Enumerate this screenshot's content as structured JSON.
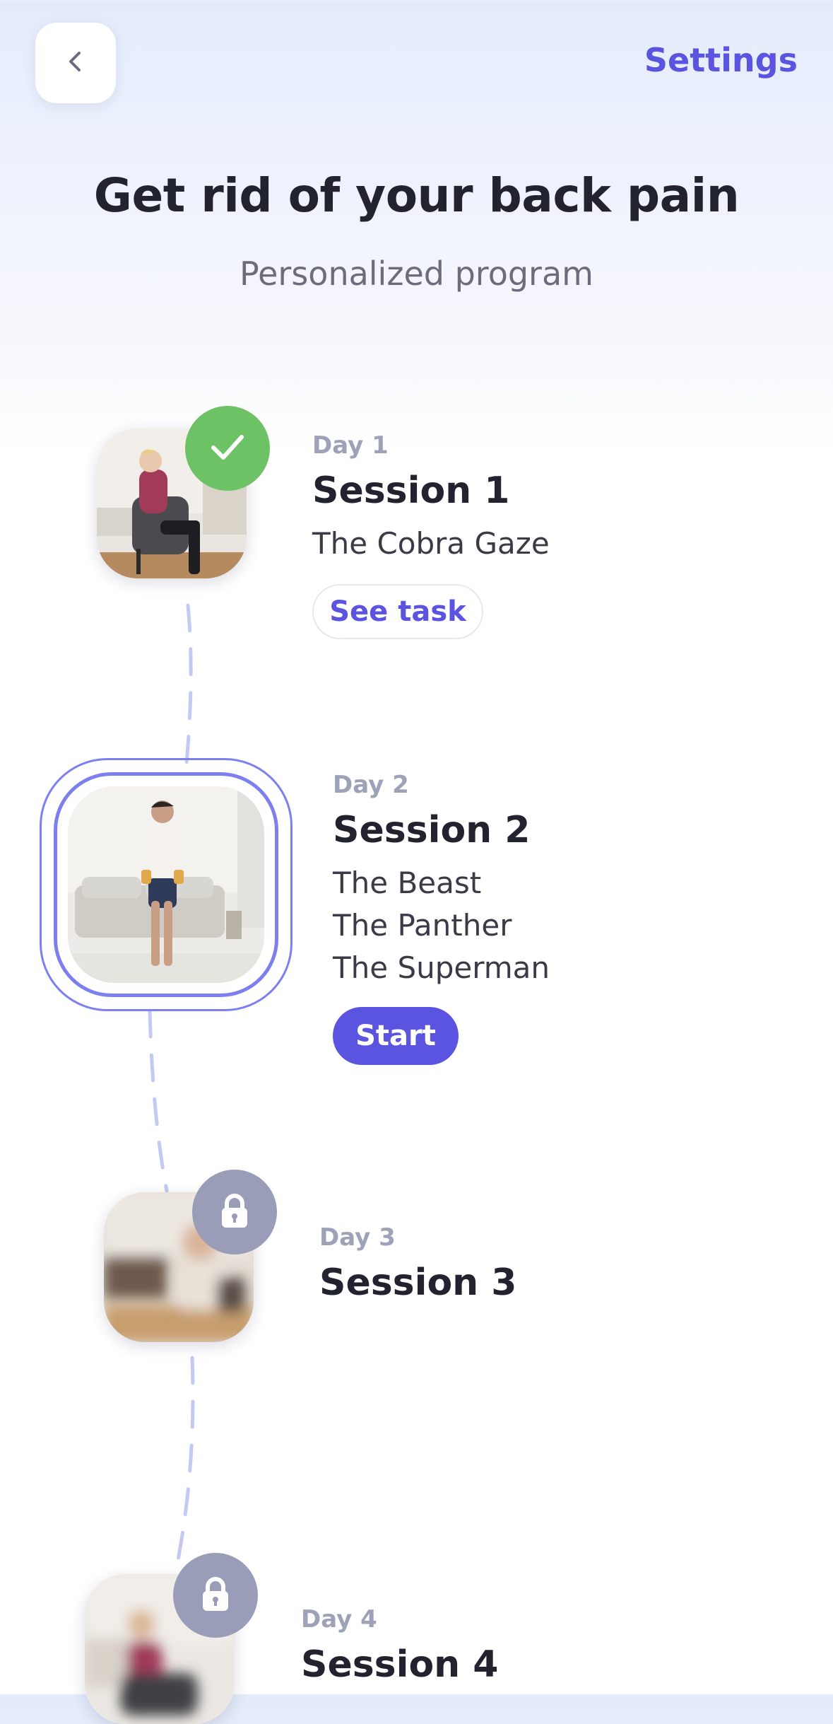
{
  "header": {
    "back_icon": "chevron-left-icon",
    "settings_label": "Settings",
    "title": "Get rid of your back pain",
    "subtitle": "Personalized program"
  },
  "colors": {
    "accent": "#5b54e0",
    "done": "#6cc264",
    "locked": "#9a9db8",
    "path": "#c3c9f3"
  },
  "sessions": [
    {
      "day": "Day 1",
      "title": "Session 1",
      "tasks": [
        "The Cobra Gaze"
      ],
      "status": "completed",
      "status_icon": "checkmark-icon",
      "action": "See task"
    },
    {
      "day": "Day 2",
      "title": "Session 2",
      "tasks": [
        "The Beast",
        "The Panther",
        "The Superman"
      ],
      "status": "current",
      "action": "Start"
    },
    {
      "day": "Day 3",
      "title": "Session 3",
      "tasks": [],
      "status": "locked",
      "status_icon": "lock-icon"
    },
    {
      "day": "Day 4",
      "title": "Session 4",
      "tasks": [],
      "status": "locked",
      "status_icon": "lock-icon"
    }
  ]
}
